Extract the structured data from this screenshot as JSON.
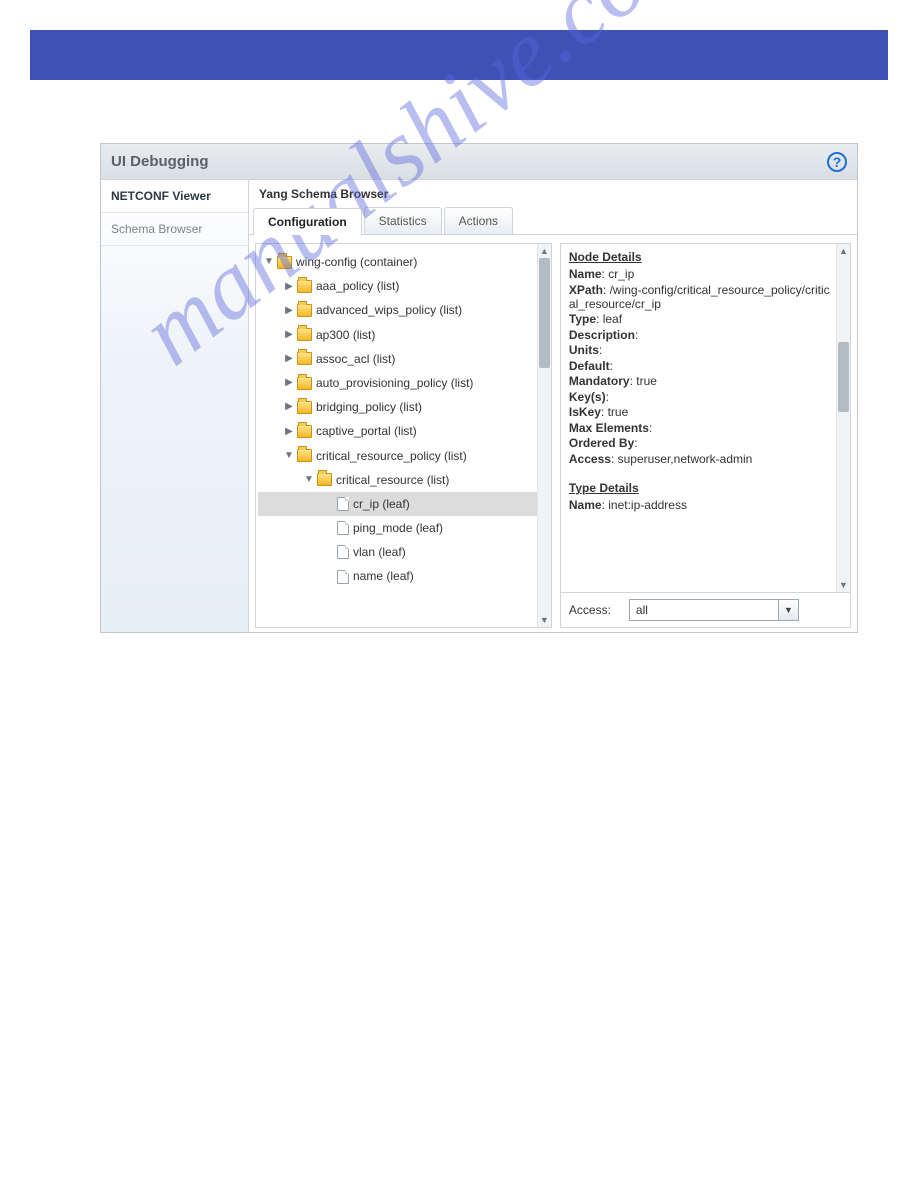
{
  "topbar": {},
  "panel": {
    "title": "UI Debugging"
  },
  "leftnav": {
    "items": [
      {
        "label": "NETCONF Viewer",
        "active": true
      },
      {
        "label": "Schema Browser",
        "active": false
      }
    ]
  },
  "section": {
    "title": "Yang Schema Browser"
  },
  "tabs": [
    {
      "label": "Configuration",
      "active": true
    },
    {
      "label": "Statistics",
      "active": false
    },
    {
      "label": "Actions",
      "active": false
    }
  ],
  "tree": [
    {
      "label": "wing-config (container)",
      "indent": 1,
      "icon": "folder",
      "expanded": true
    },
    {
      "label": "aaa_policy (list)",
      "indent": 2,
      "icon": "folder",
      "expanded": false
    },
    {
      "label": "advanced_wips_policy (list)",
      "indent": 2,
      "icon": "folder",
      "expanded": false
    },
    {
      "label": "ap300 (list)",
      "indent": 2,
      "icon": "folder",
      "expanded": false
    },
    {
      "label": "assoc_acl (list)",
      "indent": 2,
      "icon": "folder",
      "expanded": false
    },
    {
      "label": "auto_provisioning_policy (list)",
      "indent": 2,
      "icon": "folder",
      "expanded": false
    },
    {
      "label": "bridging_policy (list)",
      "indent": 2,
      "icon": "folder",
      "expanded": false
    },
    {
      "label": "captive_portal (list)",
      "indent": 2,
      "icon": "folder",
      "expanded": false
    },
    {
      "label": "critical_resource_policy (list)",
      "indent": 2,
      "icon": "folder",
      "expanded": true
    },
    {
      "label": "critical_resource (list)",
      "indent": 3,
      "icon": "folder",
      "expanded": true
    },
    {
      "label": "cr_ip (leaf)",
      "indent": 4,
      "icon": "file",
      "selected": true
    },
    {
      "label": "ping_mode (leaf)",
      "indent": 4,
      "icon": "file"
    },
    {
      "label": "vlan (leaf)",
      "indent": 4,
      "icon": "file"
    },
    {
      "label": "name (leaf)",
      "indent": 4,
      "icon": "file"
    }
  ],
  "details": {
    "heading": "Node Details",
    "name_label": "Name",
    "name": "cr_ip",
    "xpath_label": "XPath",
    "xpath": "/wing-config/critical_resource_policy/critical_resource/cr_ip",
    "type_label": "Type",
    "type": "leaf",
    "description_label": "Description",
    "description": "",
    "units_label": "Units",
    "units": "",
    "default_label": "Default",
    "default": "",
    "mandatory_label": "Mandatory",
    "mandatory": "true",
    "keys_label": "Key(s)",
    "keys": "",
    "iskey_label": "IsKey",
    "iskey": "true",
    "maxelem_label": "Max Elements",
    "maxelem": "",
    "ordered_label": "Ordered By",
    "ordered": "",
    "access_label": "Access",
    "access": "superuser,network-admin",
    "type_details_heading": "Type Details",
    "td_name_label": "Name",
    "td_name": "inet:ip-address"
  },
  "footer": {
    "access_label": "Access:",
    "access_value": "all"
  },
  "watermark": "manualshive.com"
}
